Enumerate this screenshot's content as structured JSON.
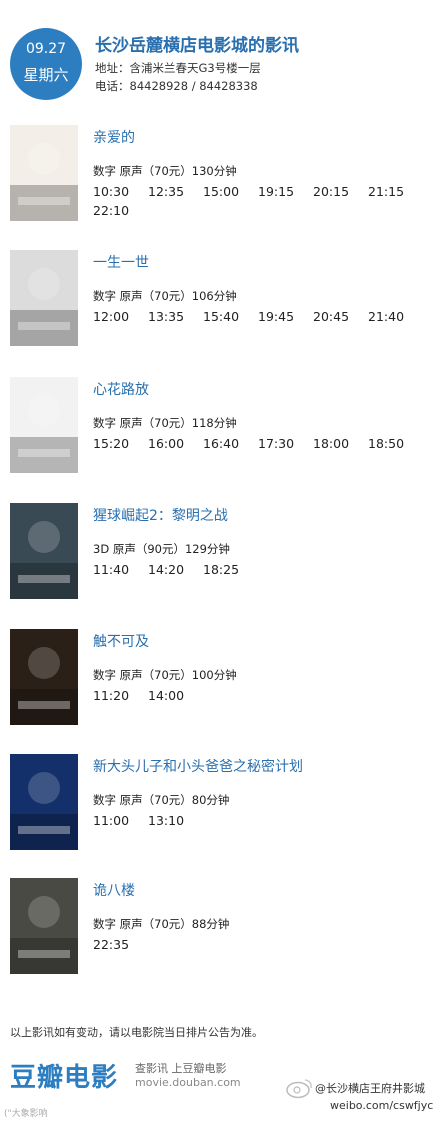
{
  "header": {
    "date": "09.27",
    "weekday": "星期六",
    "cinema": "长沙岳麓横店电影城的影讯",
    "address": "地址：含浦米兰春天G3号楼一层",
    "phone": "电话：84428928 / 84428338"
  },
  "movies": [
    {
      "title": "亲爱的",
      "meta": "数字 原声（70元）130分钟",
      "times": [
        "10:30",
        "12:35",
        "15:00",
        "19:15",
        "20:15",
        "21:15",
        "22:10"
      ],
      "poster_color": "#f3efe8",
      "poster_icon": "poster-icon"
    },
    {
      "title": "一生一世",
      "meta": "数字 原声（70元）106分钟",
      "times": [
        "12:00",
        "13:35",
        "15:40",
        "19:45",
        "20:45",
        "21:40"
      ],
      "poster_color": "#dcdcdc",
      "poster_icon": "poster-icon"
    },
    {
      "title": "心花路放",
      "meta": "数字 原声（70元）118分钟",
      "times": [
        "15:20",
        "16:00",
        "16:40",
        "17:30",
        "18:00",
        "18:50"
      ],
      "poster_color": "#f2f2f2",
      "poster_icon": "poster-icon"
    },
    {
      "title": "猩球崛起2：黎明之战",
      "meta": "3D 原声（90元）129分钟",
      "times": [
        "11:40",
        "14:20",
        "18:25"
      ],
      "poster_color": "#3a4a55",
      "poster_icon": "poster-icon"
    },
    {
      "title": "触不可及",
      "meta": "数字 原声（70元）100分钟",
      "times": [
        "11:20",
        "14:00"
      ],
      "poster_color": "#2b2018",
      "poster_icon": "poster-icon"
    },
    {
      "title": "新大头儿子和小头爸爸之秘密计划",
      "meta": "数字 原声（70元）80分钟",
      "times": [
        "11:00",
        "13:10"
      ],
      "poster_color": "#13306a",
      "poster_icon": "poster-icon"
    },
    {
      "title": "诡八楼",
      "meta": "数字 原声（70元）88分钟",
      "times": [
        "22:35"
      ],
      "poster_color": "#4a4a44",
      "poster_icon": "poster-icon"
    }
  ],
  "footer": {
    "notice": "以上影讯如有变动，请以电影院当日排片公告为准。",
    "brand": "豆瓣电影",
    "slogan": "查影讯 上豆瓣电影",
    "site": "movie.douban.com",
    "watermark_name": "@长沙横店王府井影城",
    "watermark_url": "weibo.com/cswfjyc",
    "corner_mark": "(\"大象影响"
  },
  "colors": {
    "accent": "#2d7ec0",
    "title": "#2a6fae"
  }
}
